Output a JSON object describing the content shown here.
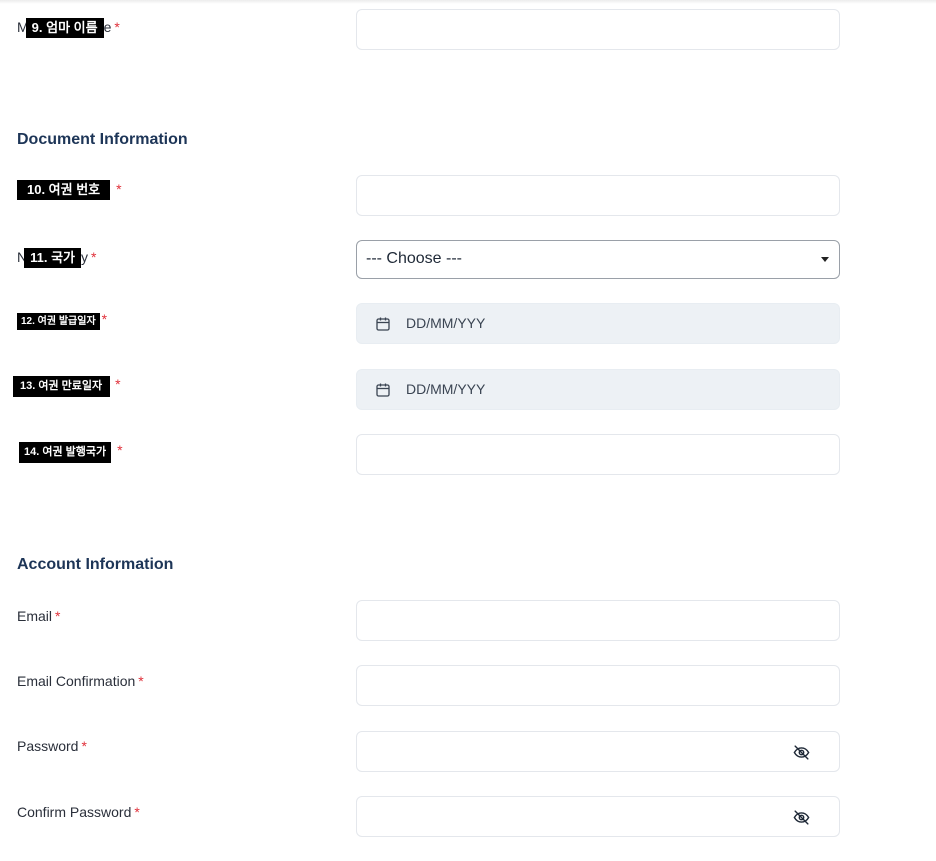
{
  "fields": {
    "mother_name": {
      "tag": "9. 엄마 이름",
      "prefix": "M",
      "suffix": "e",
      "required": "*"
    },
    "passport_number": {
      "tag": "10. 여권 번호",
      "required": "*"
    },
    "nationality": {
      "tag": "11. 국가",
      "prefix": "N",
      "suffix": "y",
      "required": "*",
      "selected": "--- Choose ---"
    },
    "issue_date": {
      "tag": "12. 여권 발급일자",
      "required": "*",
      "placeholder": "DD/MM/YYY"
    },
    "expiry_date": {
      "tag": "13. 여권 만료일자",
      "required": "*",
      "placeholder": "DD/MM/YYY"
    },
    "issuing_country": {
      "tag": "14. 여권 발행국가",
      "required": "*"
    },
    "email": {
      "label": "Email",
      "required": "*"
    },
    "email_confirmation": {
      "label": "Email Confirmation",
      "required": "*"
    },
    "password": {
      "label": "Password",
      "required": "*"
    },
    "confirm_password": {
      "label": "Confirm Password",
      "required": "*"
    }
  },
  "sections": {
    "document": "Document Information",
    "account": "Account Information"
  },
  "icons": {
    "date": "calendar-icon",
    "password_toggle": "eye-off-icon"
  },
  "colors": {
    "section_title": "#1d3557",
    "required": "#e0303a",
    "date_field_bg": "#edf1f5"
  }
}
